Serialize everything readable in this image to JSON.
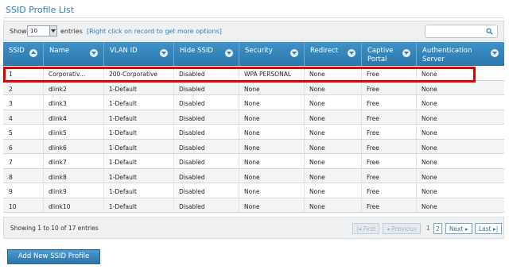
{
  "page": {
    "title": "SSID Profile List"
  },
  "toolbar": {
    "show_label": "Show",
    "page_size": "10",
    "entries_label": "entries",
    "hint": "[Right click on record to get more options]",
    "search_placeholder": ""
  },
  "table": {
    "columns": [
      "SSID",
      "Name",
      "VLAN ID",
      "Hide SSID",
      "Security",
      "Redirect",
      "Captive Portal",
      "Authentication Server"
    ],
    "rows": [
      [
        "1",
        "Corporativ...",
        "200-Corporative",
        "Disabled",
        "WPA PERSONAL",
        "None",
        "Free",
        "None"
      ],
      [
        "2",
        "dlink2",
        "1-Default",
        "Disabled",
        "None",
        "None",
        "Free",
        "None"
      ],
      [
        "3",
        "dlink3",
        "1-Default",
        "Disabled",
        "None",
        "None",
        "Free",
        "None"
      ],
      [
        "4",
        "dlink4",
        "1-Default",
        "Disabled",
        "None",
        "None",
        "Free",
        "None"
      ],
      [
        "5",
        "dlink5",
        "1-Default",
        "Disabled",
        "None",
        "None",
        "Free",
        "None"
      ],
      [
        "6",
        "dlink6",
        "1-Default",
        "Disabled",
        "None",
        "None",
        "Free",
        "None"
      ],
      [
        "7",
        "dlink7",
        "1-Default",
        "Disabled",
        "None",
        "None",
        "Free",
        "None"
      ],
      [
        "8",
        "dlink8",
        "1-Default",
        "Disabled",
        "None",
        "None",
        "Free",
        "None"
      ],
      [
        "9",
        "dlink9",
        "1-Default",
        "Disabled",
        "None",
        "None",
        "Free",
        "None"
      ],
      [
        "10",
        "dlink10",
        "1-Default",
        "Disabled",
        "None",
        "None",
        "Free",
        "None"
      ]
    ]
  },
  "footer": {
    "showing": "Showing 1 to 10 of 17 entries",
    "first": "First",
    "previous": "Previous",
    "page1": "1",
    "page2": "2",
    "next": "Next",
    "last": "Last"
  },
  "actions": {
    "add_label": "Add New SSID Profile"
  },
  "colors": {
    "header": "#2b77ad",
    "highlight": "#e00000",
    "accent": "#2b7fc0"
  }
}
